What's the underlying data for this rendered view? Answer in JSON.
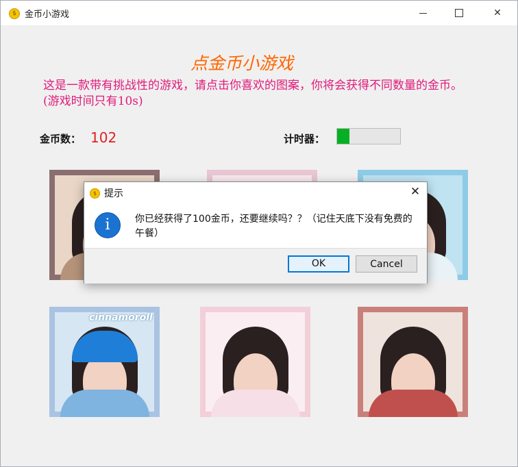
{
  "window": {
    "title": "金币小游戏",
    "app_icon": "coin-icon",
    "controls": {
      "minimize": "minimize-icon",
      "maximize": "maximize-icon",
      "close": "close-icon"
    }
  },
  "game": {
    "heading": "点金币小游戏",
    "description": "这是一款带有挑战性的游戏，请点击你喜欢的图案，你将会获得不同数量的金币。(游戏时间只有10s)",
    "coin_label": "金币数：",
    "coin_value": "102",
    "timer_label": "计时器：",
    "timer_progress_percent": 20,
    "timer_fill_color": "#06b025"
  },
  "images": [
    {
      "id": "photo-1",
      "caption": ""
    },
    {
      "id": "photo-2",
      "caption": ""
    },
    {
      "id": "photo-3",
      "caption": ""
    },
    {
      "id": "photo-4",
      "caption": "cinnamoroll"
    },
    {
      "id": "photo-5",
      "caption": ""
    },
    {
      "id": "photo-6",
      "caption": ""
    }
  ],
  "dialog": {
    "title": "提示",
    "icon": "info-icon",
    "message": "你已经获得了100金币，还要继续吗？？（记住天底下没有免费的午餐）",
    "ok_label": "OK",
    "cancel_label": "Cancel",
    "close_glyph": "✕"
  },
  "colors": {
    "heading": "#ff6600",
    "description": "#e01a7a",
    "coin_value": "#e02020",
    "accent": "#0078d7"
  }
}
